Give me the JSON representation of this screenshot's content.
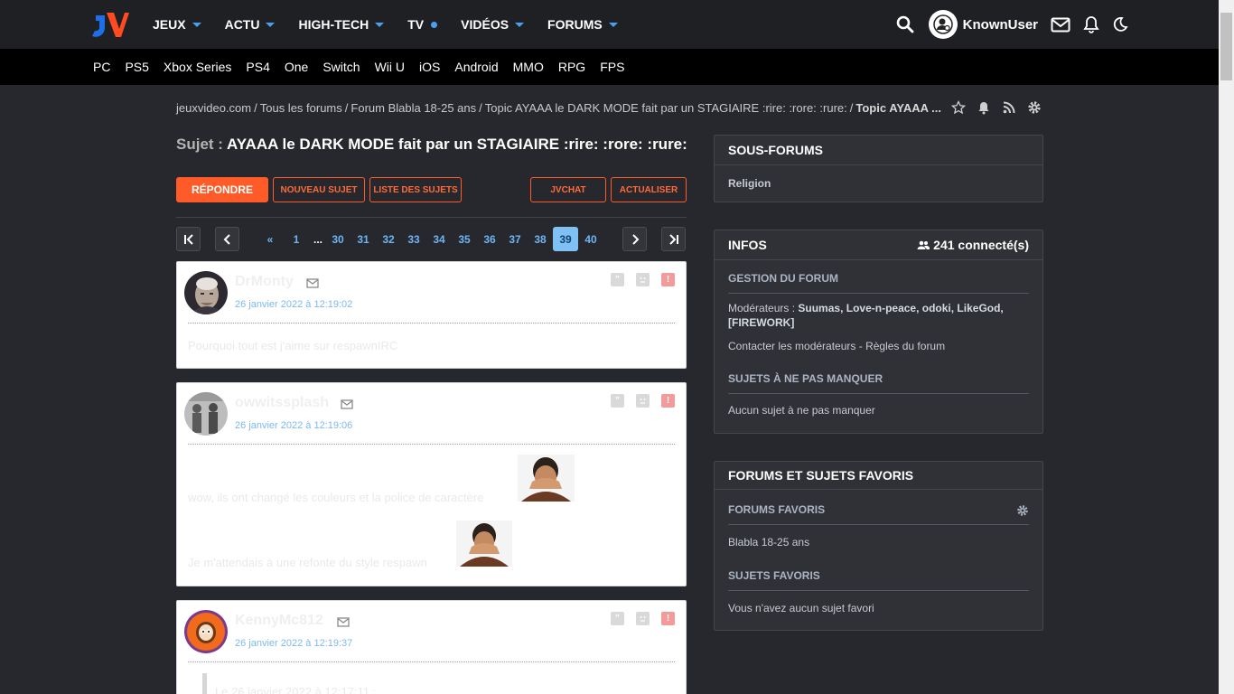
{
  "header": {
    "logo_letters": "JV",
    "nav": [
      {
        "label": "JEUX",
        "marker": "caret"
      },
      {
        "label": "ACTU",
        "marker": "caret"
      },
      {
        "label": "HIGH-TECH",
        "marker": "caret"
      },
      {
        "label": "TV",
        "marker": "dot"
      },
      {
        "label": "VIDÉOS",
        "marker": "caret"
      },
      {
        "label": "FORUMS",
        "marker": "caret"
      }
    ],
    "username": "KnownUser",
    "icons": [
      "search-icon",
      "user-avatar-icon",
      "mail-icon",
      "bell-icon",
      "moon-icon"
    ]
  },
  "subnav": [
    "PC",
    "PS5",
    "Xbox Series",
    "PS4",
    "One",
    "Switch",
    "Wii U",
    "iOS",
    "Android",
    "MMO",
    "RPG",
    "FPS"
  ],
  "breadcrumb": {
    "items": [
      "jeuxvideo.com",
      "Tous les forums",
      "Forum Blabla 18-25 ans",
      "Topic AYAAA le DARK MODE fait par un STAGIAIRE :rire: :rore: :rure:"
    ],
    "current": "Topic AYAAA ...",
    "separator": "/"
  },
  "topic": {
    "label": "Sujet :",
    "title": "AYAAA le DARK MODE fait par un STAGIAIRE :rire: :rore: :rure:"
  },
  "buttons": {
    "reply": "RÉPONDRE",
    "new_topic": "NOUVEAU SUJET",
    "topic_list": "LISTE DES SUJETS",
    "jvchat": "JVCHAT",
    "refresh": "ACTUALISER"
  },
  "pagination": {
    "first": "1",
    "dots": "...",
    "prev_arrow": "«",
    "pages": [
      "30",
      "31",
      "32",
      "33",
      "34",
      "35",
      "36",
      "37",
      "38",
      "39",
      "40"
    ],
    "current": "39"
  },
  "posts": [
    {
      "author": "DrMonty",
      "date": "26 janvier 2022 à 12:19:02",
      "lines": [
        "Pourquoi tout est j'aime sur respawnIRC"
      ]
    },
    {
      "author": "owwitssplash",
      "date": "26 janvier 2022 à 12:19:06",
      "lines": [
        "wow, ils ont changé les couleurs et la police de caractère",
        "Je m'attendais à une refonte du style respawn"
      ]
    },
    {
      "author": "KennyMc812",
      "date": "26 janvier 2022 à 12:19:37",
      "lines": [
        "Le 26 janvier 2022 à 12:17:11 :"
      ]
    }
  ],
  "post_tools": {
    "quote": "”",
    "report": "!"
  },
  "sidebar": {
    "subforums": {
      "title": "SOUS-FORUMS",
      "items": [
        "Religion"
      ]
    },
    "infos": {
      "title": "INFOS",
      "connected": "241 connecté(s)",
      "management_title": "GESTION DU FORUM",
      "moderators_label": "Modérateurs :",
      "moderators": "Suumas, Love-n-peace, odoki, LikeGod,",
      "moderators_2": "[FIREWORK]",
      "contact": "Contacter les modérateurs - Règles du forum",
      "must_read_title": "SUJETS À NE PAS MANQUER",
      "must_read_empty": "Aucun sujet à ne pas manquer"
    },
    "favorites": {
      "title": "FORUMS ET SUJETS FAVORIS",
      "forums_title": "FORUMS FAVORIS",
      "forums": [
        "Blabla 18-25 ans"
      ],
      "topics_title": "SUJETS FAVORIS",
      "topics_empty": "Vous n'avez aucun sujet favori"
    }
  },
  "colors": {
    "accent": "#ff5b29",
    "link": "#6fb4f5",
    "background": "#26282d"
  }
}
